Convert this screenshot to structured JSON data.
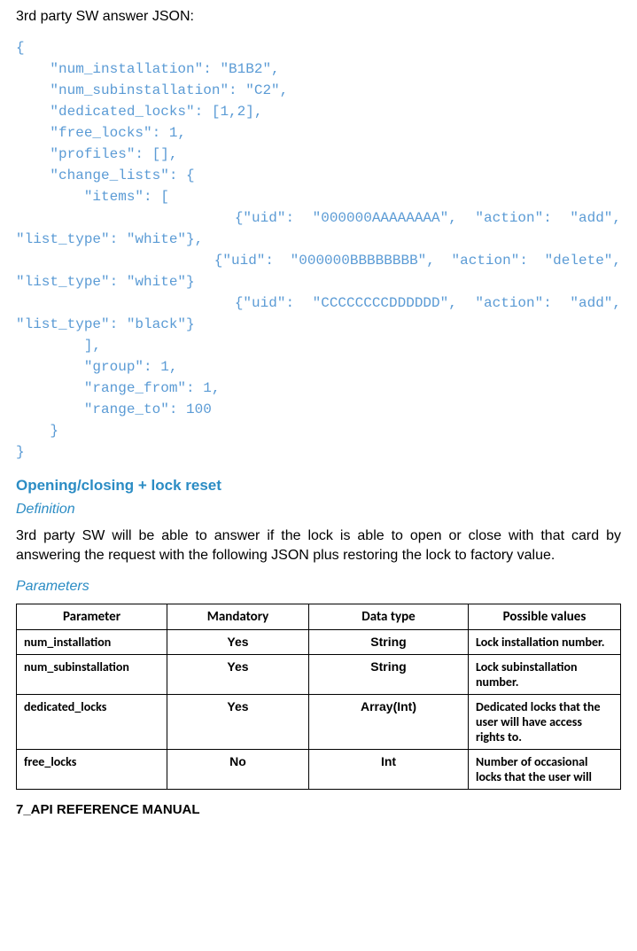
{
  "intro": "3rd party SW answer JSON:",
  "code_lines": [
    "{",
    "    \"num_installation\": \"B1B2\",",
    "    \"num_subinstallation\": \"C2\",",
    "    \"dedicated_locks\": [1,2],",
    "    \"free_locks\": 1,",
    "    \"profiles\": [],",
    "    \"change_lists\": {",
    "        \"items\": ["
  ],
  "code_justify_lines": [
    {
      "main": "            {\"uid\":   \"000000AAAAAAAA\",   \"action\":   \"add\",",
      "cont": "\"list_type\": \"white\"},"
    },
    {
      "main": "            {\"uid\":  \"000000BBBBBBBB\",  \"action\":  \"delete\",",
      "cont": "\"list_type\": \"white\"}"
    },
    {
      "main": "            {\"uid\":   \"CCCCCCCCDDDDDD\",   \"action\":   \"add\",",
      "cont": "\"list_type\": \"black\"}"
    }
  ],
  "code_tail": [
    "        ],",
    "        \"group\": 1,",
    "        \"range_from\": 1,",
    "        \"range_to\": 100",
    "    }",
    "}"
  ],
  "heading": "Opening/closing + lock reset",
  "definition_label": "Definition",
  "definition_body": "3rd party SW will be able to answer if the lock is able to open or close with that card by answering the request with the following JSON plus restoring the lock to factory value.",
  "parameters_label": "Parameters",
  "table": {
    "headers": [
      "Parameter",
      "Mandatory",
      "Data type",
      "Possible values"
    ],
    "rows": [
      {
        "param": "num_installation",
        "mandatory": "Yes",
        "type": "String",
        "desc": "Lock installation number."
      },
      {
        "param": "num_subinstallation",
        "mandatory": "Yes",
        "type": "String",
        "desc": "Lock subinstallation number."
      },
      {
        "param": "dedicated_locks",
        "mandatory": "Yes",
        "type": "Array(Int)",
        "desc": "Dedicated locks that the user will have access rights to."
      },
      {
        "param": "free_locks",
        "mandatory": "No",
        "type": "Int",
        "desc": "Number of occasional locks that the user will"
      }
    ]
  },
  "footer": "7_API REFERENCE MANUAL"
}
